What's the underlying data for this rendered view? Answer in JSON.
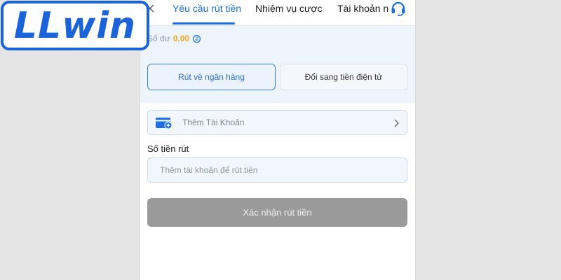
{
  "brand": {
    "logo_text": "LLwin",
    "color": "#1a63d8"
  },
  "header": {
    "tabs": [
      {
        "label": "Yêu cầu rút tiền",
        "active": true
      },
      {
        "label": "Nhiệm vụ cược",
        "active": false
      },
      {
        "label": "Tài khoản n",
        "active": false
      }
    ],
    "close_icon": "close-icon",
    "support_icon": "headset-icon"
  },
  "balance": {
    "label": "Số dư",
    "value": "0.00",
    "refresh_icon": "refresh-icon"
  },
  "methods": [
    {
      "label": "Rút về ngân hàng",
      "active": true
    },
    {
      "label": "Đổi sang tiền điện tử",
      "active": false
    }
  ],
  "account": {
    "label": "Thêm Tài Khoản",
    "icon": "wallet-add-icon"
  },
  "amount": {
    "label": "Số tiền rút",
    "placeholder": "Thêm tài khoản để rút tiền",
    "value": ""
  },
  "confirm": {
    "label": "Xác nhận rút tiền"
  },
  "colors": {
    "accent": "#1b6fe0",
    "balance": "#f5a623",
    "disabled_button": "#9a9a9a",
    "panel_bg": "#eef4fb"
  }
}
